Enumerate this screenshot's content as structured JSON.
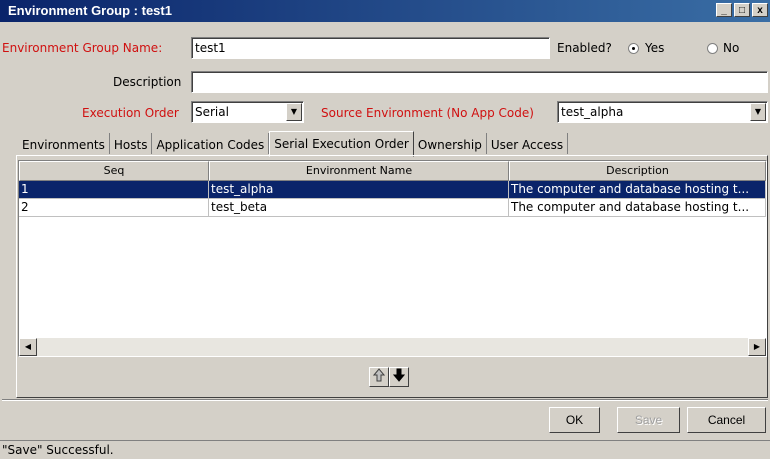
{
  "window": {
    "title": "Environment Group : test1",
    "controls": {
      "minimize": "_",
      "maximize": "□",
      "close": "x"
    }
  },
  "form": {
    "group_name_label": "Environment Group Name:",
    "group_name_value": "test1",
    "enabled_label": "Enabled?",
    "enabled_yes": "Yes",
    "enabled_no": "No",
    "enabled_value": "Yes",
    "description_label": "Description",
    "description_value": "",
    "execution_order_label": "Execution Order",
    "execution_order_value": "Serial",
    "source_env_label": "Source Environment (No App Code)",
    "source_env_value": "test_alpha"
  },
  "tabs": [
    {
      "label": "Environments",
      "active": false
    },
    {
      "label": "Hosts",
      "active": false
    },
    {
      "label": "Application Codes",
      "active": false
    },
    {
      "label": "Serial Execution Order",
      "active": true
    },
    {
      "label": "Ownership",
      "active": false
    },
    {
      "label": "User Access",
      "active": false
    }
  ],
  "table": {
    "columns": [
      "Seq",
      "Environment Name",
      "Description"
    ],
    "rows": [
      {
        "seq": "1",
        "name": "test_alpha",
        "description": "The computer and database hosting t...",
        "selected": true
      },
      {
        "seq": "2",
        "name": "test_beta",
        "description": "The computer and database hosting t...",
        "selected": false
      }
    ]
  },
  "buttons": {
    "ok": "OK",
    "save": "Save",
    "cancel": "Cancel"
  },
  "status": "\"Save\" Successful.",
  "colors": {
    "title_bar": "#0a246a",
    "required_label": "#d01010",
    "selection": "#0a246a"
  }
}
